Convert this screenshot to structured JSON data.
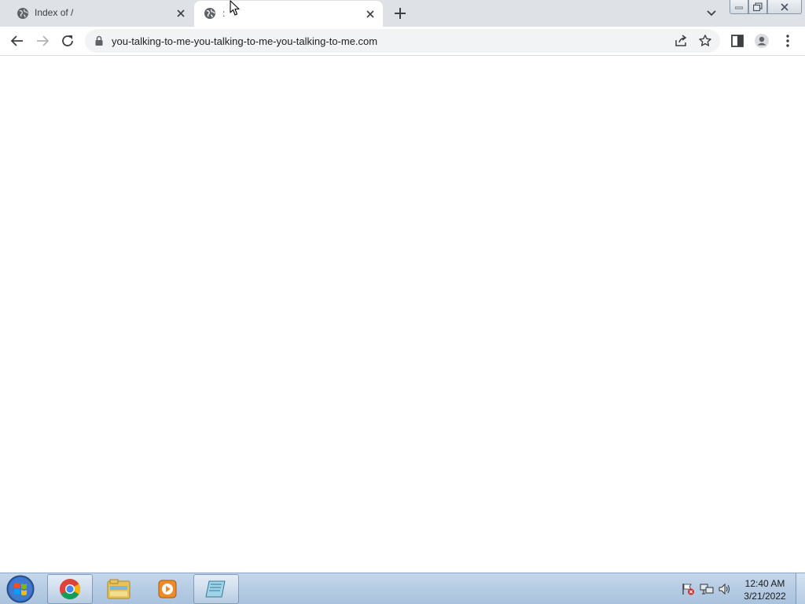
{
  "browser": {
    "tabs": [
      {
        "title": "Index of /",
        "active": false
      },
      {
        "title": ":",
        "active": true
      }
    ],
    "url": "you-talking-to-me-you-talking-to-me-you-talking-to-me.com",
    "icons": {
      "back": "back-arrow-icon",
      "forward": "forward-arrow-icon",
      "reload": "reload-icon",
      "lock": "lock-icon",
      "share": "share-icon",
      "bookmark": "star-icon",
      "side_panel": "side-panel-icon",
      "profile": "profile-icon",
      "menu": "kebab-menu-icon"
    }
  },
  "taskbar": {
    "apps": [
      "chrome-icon",
      "file-explorer-icon",
      "media-player-icon",
      "notepad-icon"
    ],
    "clock": {
      "time": "12:40 AM",
      "date": "3/21/2022"
    }
  },
  "colors": {
    "tabstrip": "#dee1e6",
    "omnibox": "#f1f3f4",
    "taskbar": "#b9cfe6"
  }
}
